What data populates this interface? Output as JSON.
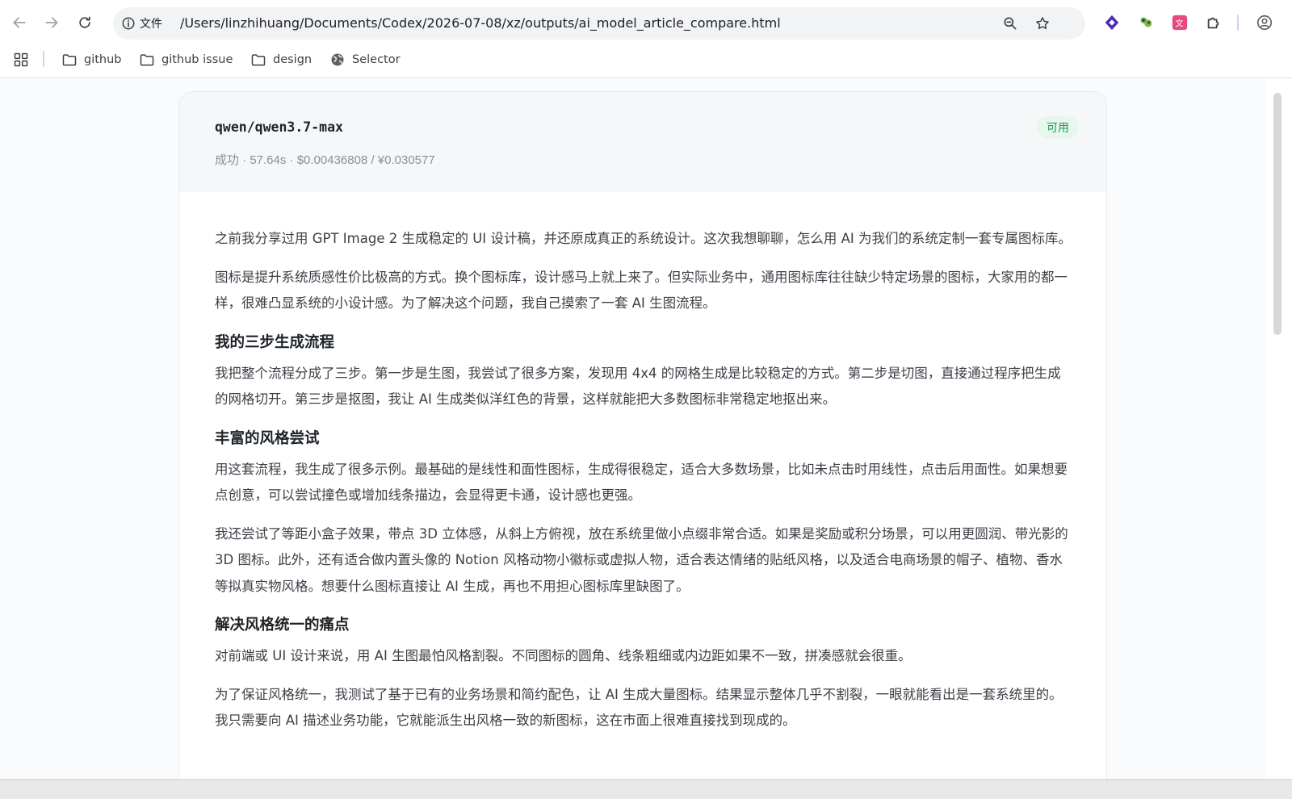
{
  "browser": {
    "site_info_label": "文件",
    "url": "/Users/linzhihuang/Documents/Codex/2026-07-08/xz/outputs/ai_model_article_compare.html",
    "bookmarks": [
      {
        "label": "github"
      },
      {
        "label": "github issue"
      },
      {
        "label": "design"
      },
      {
        "label": "Selector"
      }
    ]
  },
  "result": {
    "model": "qwen/qwen3.7-max",
    "status": "可用",
    "meta": "成功 · 57.64s · $0.00436808 / ¥0.030577"
  },
  "article": {
    "p1": "之前我分享过用 GPT Image 2 生成稳定的 UI 设计稿，并还原成真正的系统设计。这次我想聊聊，怎么用 AI 为我们的系统定制一套专属图标库。",
    "p2": "图标是提升系统质感性价比极高的方式。换个图标库，设计感马上就上来了。但实际业务中，通用图标库往往缺少特定场景的图标，大家用的都一样，很难凸显系统的小设计感。为了解决这个问题，我自己摸索了一套 AI 生图流程。",
    "h1": "我的三步生成流程",
    "p3": "我把整个流程分成了三步。第一步是生图，我尝试了很多方案，发现用 4x4 的网格生成是比较稳定的方式。第二步是切图，直接通过程序把生成的网格切开。第三步是抠图，我让 AI 生成类似洋红色的背景，这样就能把大多数图标非常稳定地抠出来。",
    "h2": "丰富的风格尝试",
    "p4": "用这套流程，我生成了很多示例。最基础的是线性和面性图标，生成得很稳定，适合大多数场景，比如未点击时用线性，点击后用面性。如果想要点创意，可以尝试撞色或增加线条描边，会显得更卡通，设计感也更强。",
    "p5": "我还尝试了等距小盒子效果，带点 3D 立体感，从斜上方俯视，放在系统里做小点缀非常合适。如果是奖励或积分场景，可以用更圆润、带光影的 3D 图标。此外，还有适合做内置头像的 Notion 风格动物小徽标或虚拟人物，适合表达情绪的贴纸风格，以及适合电商场景的帽子、植物、香水等拟真实物风格。想要什么图标直接让 AI 生成，再也不用担心图标库里缺图了。",
    "h3": "解决风格统一的痛点",
    "p6": "对前端或 UI 设计来说，用 AI 生图最怕风格割裂。不同图标的圆角、线条粗细或内边距如果不一致，拼凑感就会很重。",
    "p7": "为了保证风格统一，我测试了基于已有的业务场景和简约配色，让 AI 生成大量图标。结果显示整体几乎不割裂，一眼就能看出是一套系统里的。我只需要向 AI 描述业务功能，它就能派生出风格一致的新图标，这在市面上很难直接找到现成的。"
  },
  "colors": {
    "status_green": "#1a9b55",
    "status_bg": "#e8f7ee",
    "card_head_bg": "#f6f7f8"
  }
}
